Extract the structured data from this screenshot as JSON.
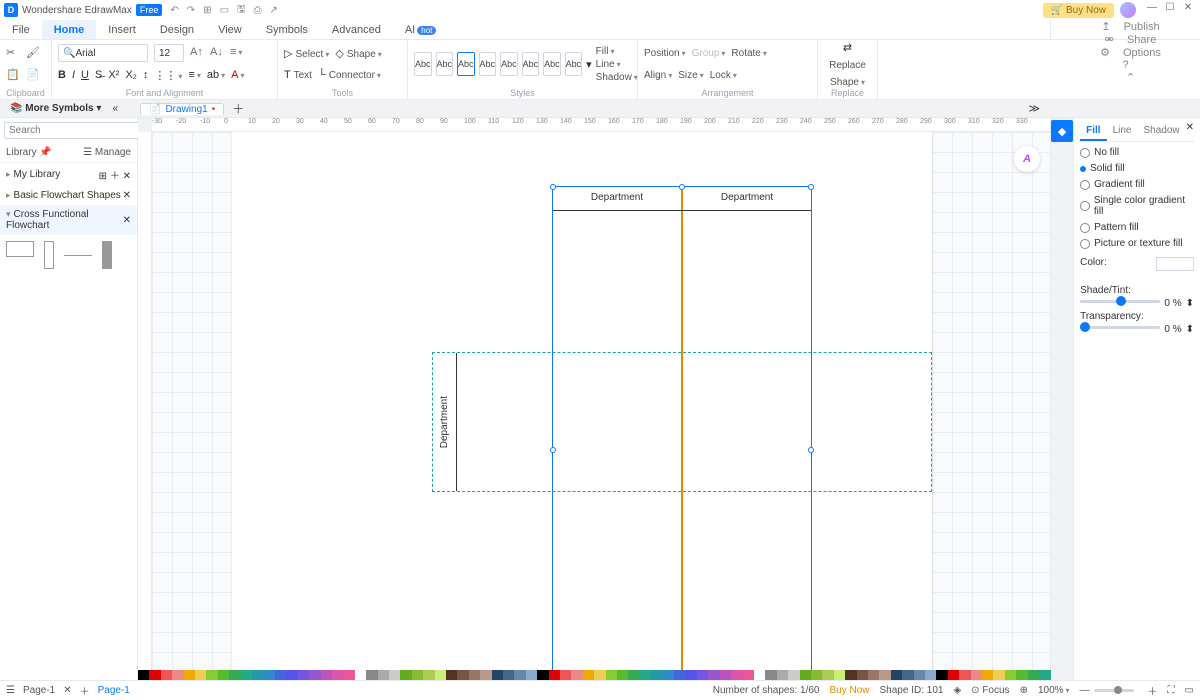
{
  "titlebar": {
    "app": "Wondershare EdrawMax",
    "badge": "Free",
    "buy": "Buy Now"
  },
  "menu": {
    "items": [
      "File",
      "Home",
      "Insert",
      "Design",
      "View",
      "Symbols",
      "Advanced",
      "AI"
    ],
    "active": 1,
    "hot": "hot",
    "right": [
      "Publish",
      "Share",
      "Options"
    ]
  },
  "ribbon": {
    "clipboard": "Clipboard",
    "font": {
      "name": "Arial",
      "size": "12",
      "group": "Font and Alignment"
    },
    "tools": {
      "select": "Select",
      "shape": "Shape",
      "text": "Text",
      "connector": "Connector",
      "group": "Tools"
    },
    "styles": {
      "label": "Abc",
      "group": "Styles"
    },
    "style2": {
      "fill": "Fill",
      "line": "Line",
      "shadow": "Shadow"
    },
    "arrange": {
      "position": "Position",
      "align": "Align",
      "group_": "Group",
      "size": "Size",
      "rotate": "Rotate",
      "lock": "Lock",
      "grouplabel": "Arrangement"
    },
    "replace": {
      "top": "Replace",
      "bot": "Shape",
      "group": "Replace"
    }
  },
  "doctabs": {
    "more": "More Symbols",
    "drawing": "Drawing1"
  },
  "left": {
    "search_ph": "Search",
    "search_btn": "Search",
    "library": "Library",
    "manage": "Manage",
    "mylib": "My Library",
    "cat1": "Basic Flowchart Shapes",
    "cat2": "Cross Functional Flowchart"
  },
  "canvas": {
    "dept": "Department"
  },
  "rightpanel": {
    "tabs": [
      "Fill",
      "Line",
      "Shadow"
    ],
    "opts": [
      "No fill",
      "Solid fill",
      "Gradient fill",
      "Single color gradient fill",
      "Pattern fill",
      "Picture or texture fill"
    ],
    "selected": 1,
    "color": "Color:",
    "shade": "Shade/Tint:",
    "trans": "Transparency:",
    "pct": "0 %"
  },
  "status": {
    "page": "Page-1",
    "page2": "Page-1",
    "shapes": "Number of shapes: 1/60",
    "buy": "Buy Now",
    "shapeid": "Shape ID: 101",
    "focus": "Focus",
    "zoom": "100%"
  },
  "ruler": [
    -30,
    -20,
    -10,
    0,
    10,
    20,
    30,
    40,
    50,
    60,
    70,
    80,
    90,
    100,
    110,
    120,
    130,
    140,
    150,
    160,
    170,
    180,
    190,
    200,
    210,
    220,
    230,
    240,
    250,
    260,
    270,
    280,
    290,
    300,
    310,
    320,
    330
  ]
}
